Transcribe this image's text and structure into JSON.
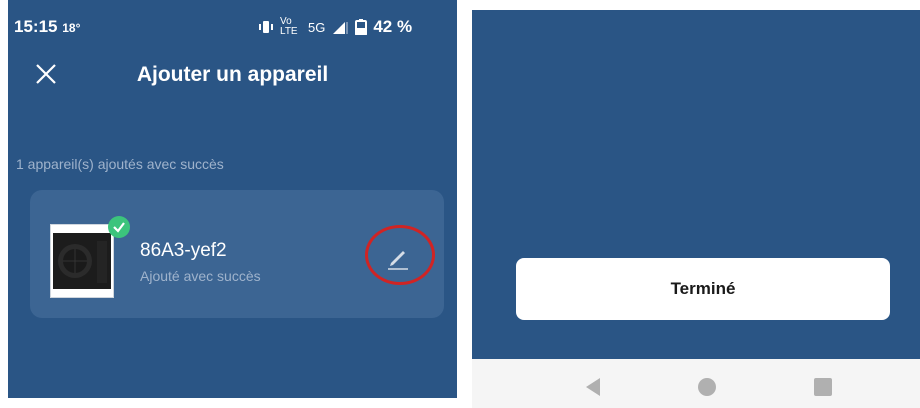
{
  "status_bar": {
    "time": "15:15",
    "temperature": "18°",
    "network": "5G",
    "volte": "Vo LTE",
    "battery": "42 %"
  },
  "header": {
    "title": "Ajouter un appareil",
    "close_icon": "close-icon"
  },
  "success_message": "1 appareil(s) ajoutés avec succès",
  "device": {
    "name": "86A3-yef2",
    "status": "Ajouté avec succès",
    "icon": "heat-pump-image",
    "badge": "check-icon",
    "edit_icon": "pencil-icon"
  },
  "actions": {
    "done_label": "Terminé"
  },
  "navigation": {
    "back": "back-icon",
    "home": "home-icon",
    "recent": "recent-apps-icon"
  },
  "colors": {
    "background": "#2a5585",
    "card": "#3c6593",
    "accent_green": "#3cc47c",
    "highlight_red": "#d02424"
  }
}
